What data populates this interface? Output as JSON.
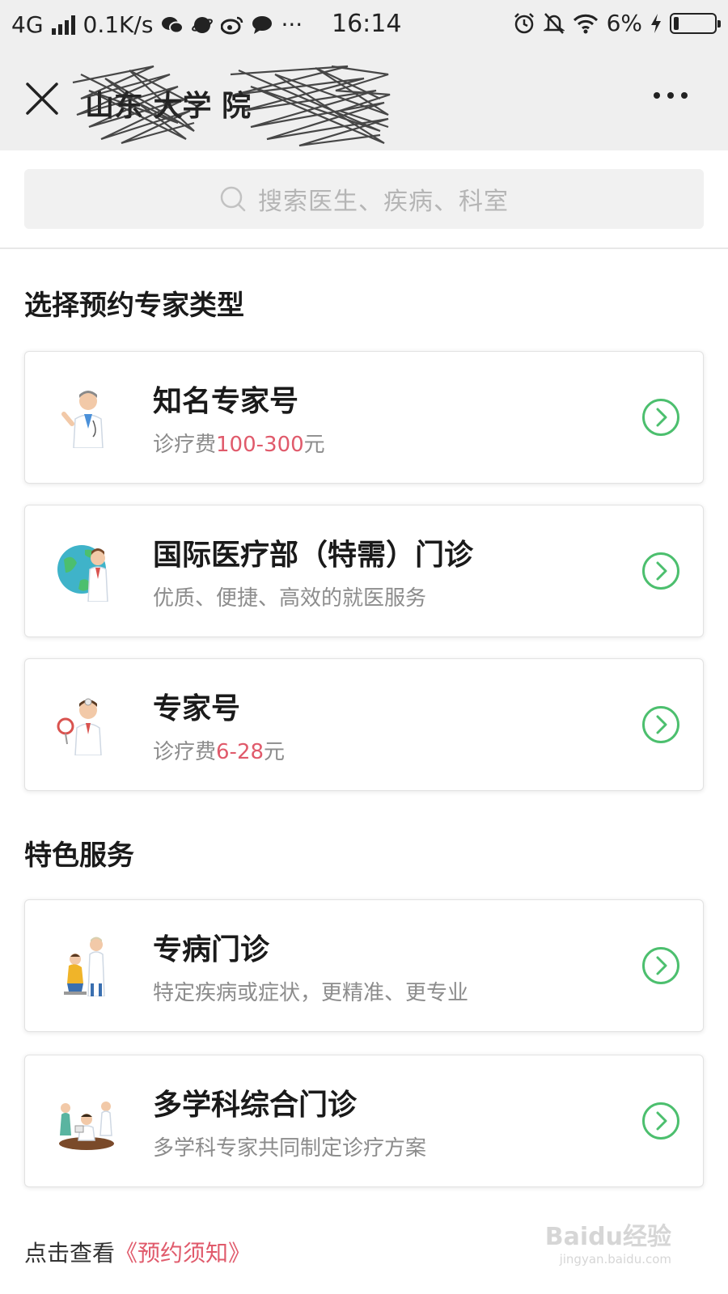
{
  "status_bar": {
    "network": "4G",
    "speed": "0.1K/s",
    "more": "···",
    "time": "16:14",
    "battery": "6%",
    "battery_level": 0.06
  },
  "nav": {
    "title": "山东 大学 院",
    "close_icon": "close-icon",
    "more_icon": "more-icon"
  },
  "search": {
    "placeholder": "搜索医生、疾病、科室",
    "icon": "search-icon"
  },
  "sections": {
    "booking_title": "选择预约专家类型",
    "special_title": "特色服务"
  },
  "cards": [
    {
      "title": "知名专家号",
      "sub_prefix": "诊疗费",
      "sub_price": "100-300",
      "sub_suffix": "元",
      "icon": "doctor-waving-icon"
    },
    {
      "title": "国际医疗部（特需）门诊",
      "sub": "优质、便捷、高效的就医服务",
      "icon": "globe-doctor-icon"
    },
    {
      "title": "专家号",
      "sub_prefix": "诊疗费",
      "sub_price": "6-28",
      "sub_suffix": "元",
      "icon": "doctor-sign-icon"
    },
    {
      "title": "专病门诊",
      "sub": "特定疾病或症状，更精准、更专业",
      "icon": "doctor-patient-icon"
    },
    {
      "title": "多学科综合门诊",
      "sub": "多学科专家共同制定诊疗方案",
      "icon": "team-doctors-icon"
    }
  ],
  "notice": {
    "prefix": "点击查看",
    "link": "《预约须知》"
  },
  "watermark": {
    "brand": "Baidu经验",
    "url": "jingyan.baidu.com"
  },
  "colors": {
    "accent_green": "#4cbf6e",
    "price_red": "#e05a6b"
  }
}
